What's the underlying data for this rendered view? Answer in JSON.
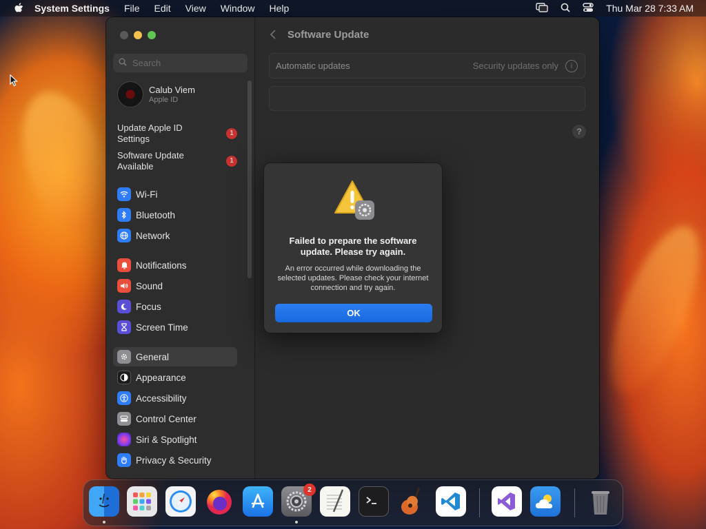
{
  "menubar": {
    "app_name": "System Settings",
    "menus": [
      "File",
      "Edit",
      "View",
      "Window",
      "Help"
    ],
    "clock": "Thu Mar 28  7:33 AM",
    "status_icons": [
      "screen-mirroring-icon",
      "spotlight-search-icon",
      "control-center-icon"
    ]
  },
  "sidebar": {
    "search_placeholder": "Search",
    "account": {
      "name": "Calub Viem",
      "subtitle": "Apple ID"
    },
    "notices": [
      {
        "label": "Update Apple ID Settings",
        "badge": "1"
      },
      {
        "label": "Software Update Available",
        "badge": "1"
      }
    ],
    "groups": [
      [
        {
          "label": "Wi-Fi",
          "icon": "wifi-icon",
          "color": "#2f7cf6"
        },
        {
          "label": "Bluetooth",
          "icon": "bluetooth-icon",
          "color": "#2f7cf6"
        },
        {
          "label": "Network",
          "icon": "globe-icon",
          "color": "#2f7cf6"
        }
      ],
      [
        {
          "label": "Notifications",
          "icon": "bell-icon",
          "color": "#ea4e3d"
        },
        {
          "label": "Sound",
          "icon": "speaker-icon",
          "color": "#ea4e3d"
        },
        {
          "label": "Focus",
          "icon": "moon-icon",
          "color": "#5b4fd6"
        },
        {
          "label": "Screen Time",
          "icon": "hourglass-icon",
          "color": "#5b4fd6"
        }
      ],
      [
        {
          "label": "General",
          "icon": "gear-icon",
          "color": "#8e8e93",
          "selected": true
        },
        {
          "label": "Appearance",
          "icon": "appearance-icon",
          "color": "#1c1c1e"
        },
        {
          "label": "Accessibility",
          "icon": "accessibility-icon",
          "color": "#2f7cf6"
        },
        {
          "label": "Control Center",
          "icon": "control-center-icon",
          "color": "#8e8e93"
        },
        {
          "label": "Siri & Spotlight",
          "icon": "siri-icon",
          "color": "#b04fd6"
        },
        {
          "label": "Privacy & Security",
          "icon": "hand-icon",
          "color": "#2f7cf6"
        }
      ]
    ]
  },
  "main": {
    "title": "Software Update",
    "automatic_updates": {
      "label": "Automatic updates",
      "value": "Security updates only"
    }
  },
  "dialog": {
    "title": "Failed to prepare the software update. Please try again.",
    "message": "An error occurred while downloading the selected updates. Please check your internet connection and try again.",
    "ok_label": "OK"
  },
  "dock": {
    "apps": [
      {
        "name": "Finder",
        "icon": "finder-icon",
        "running": true
      },
      {
        "name": "Launchpad",
        "icon": "launchpad-icon"
      },
      {
        "name": "Safari",
        "icon": "safari-icon"
      },
      {
        "name": "Firefox",
        "icon": "firefox-icon"
      },
      {
        "name": "App Store",
        "icon": "app-store-icon"
      },
      {
        "name": "System Settings",
        "icon": "system-settings-icon",
        "badge": "2",
        "running": true
      },
      {
        "name": "TextEdit",
        "icon": "textedit-icon"
      },
      {
        "name": "Terminal",
        "icon": "terminal-icon"
      },
      {
        "name": "GarageBand",
        "icon": "garageband-icon"
      },
      {
        "name": "Visual Studio Code",
        "icon": "vscode-icon"
      },
      {
        "name": "Visual Studio",
        "icon": "visual-studio-icon"
      },
      {
        "name": "Weather",
        "icon": "weather-icon"
      },
      {
        "name": "Trash",
        "icon": "trash-icon"
      }
    ]
  },
  "colors": {
    "accent_blue": "#1a6fe0",
    "badge_red": "#c7322e",
    "traffic_min": "#f5bf4f",
    "traffic_max": "#61c554"
  }
}
